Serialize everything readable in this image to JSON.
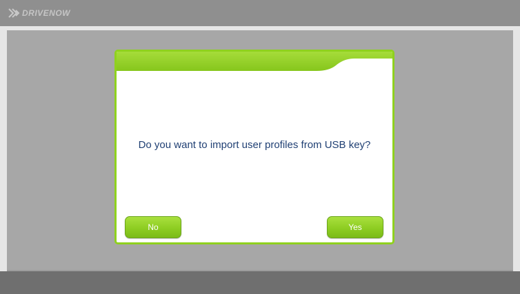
{
  "app": {
    "brand": "DRIVENOW"
  },
  "dialog": {
    "message": "Do you want to import user profiles from USB key?",
    "no_label": "No",
    "yes_label": "Yes"
  },
  "colors": {
    "accent": "#8fd11e",
    "message_text": "#1f3f73",
    "topbar": "#8f8f8f",
    "content_bg": "#a7a7a7"
  }
}
